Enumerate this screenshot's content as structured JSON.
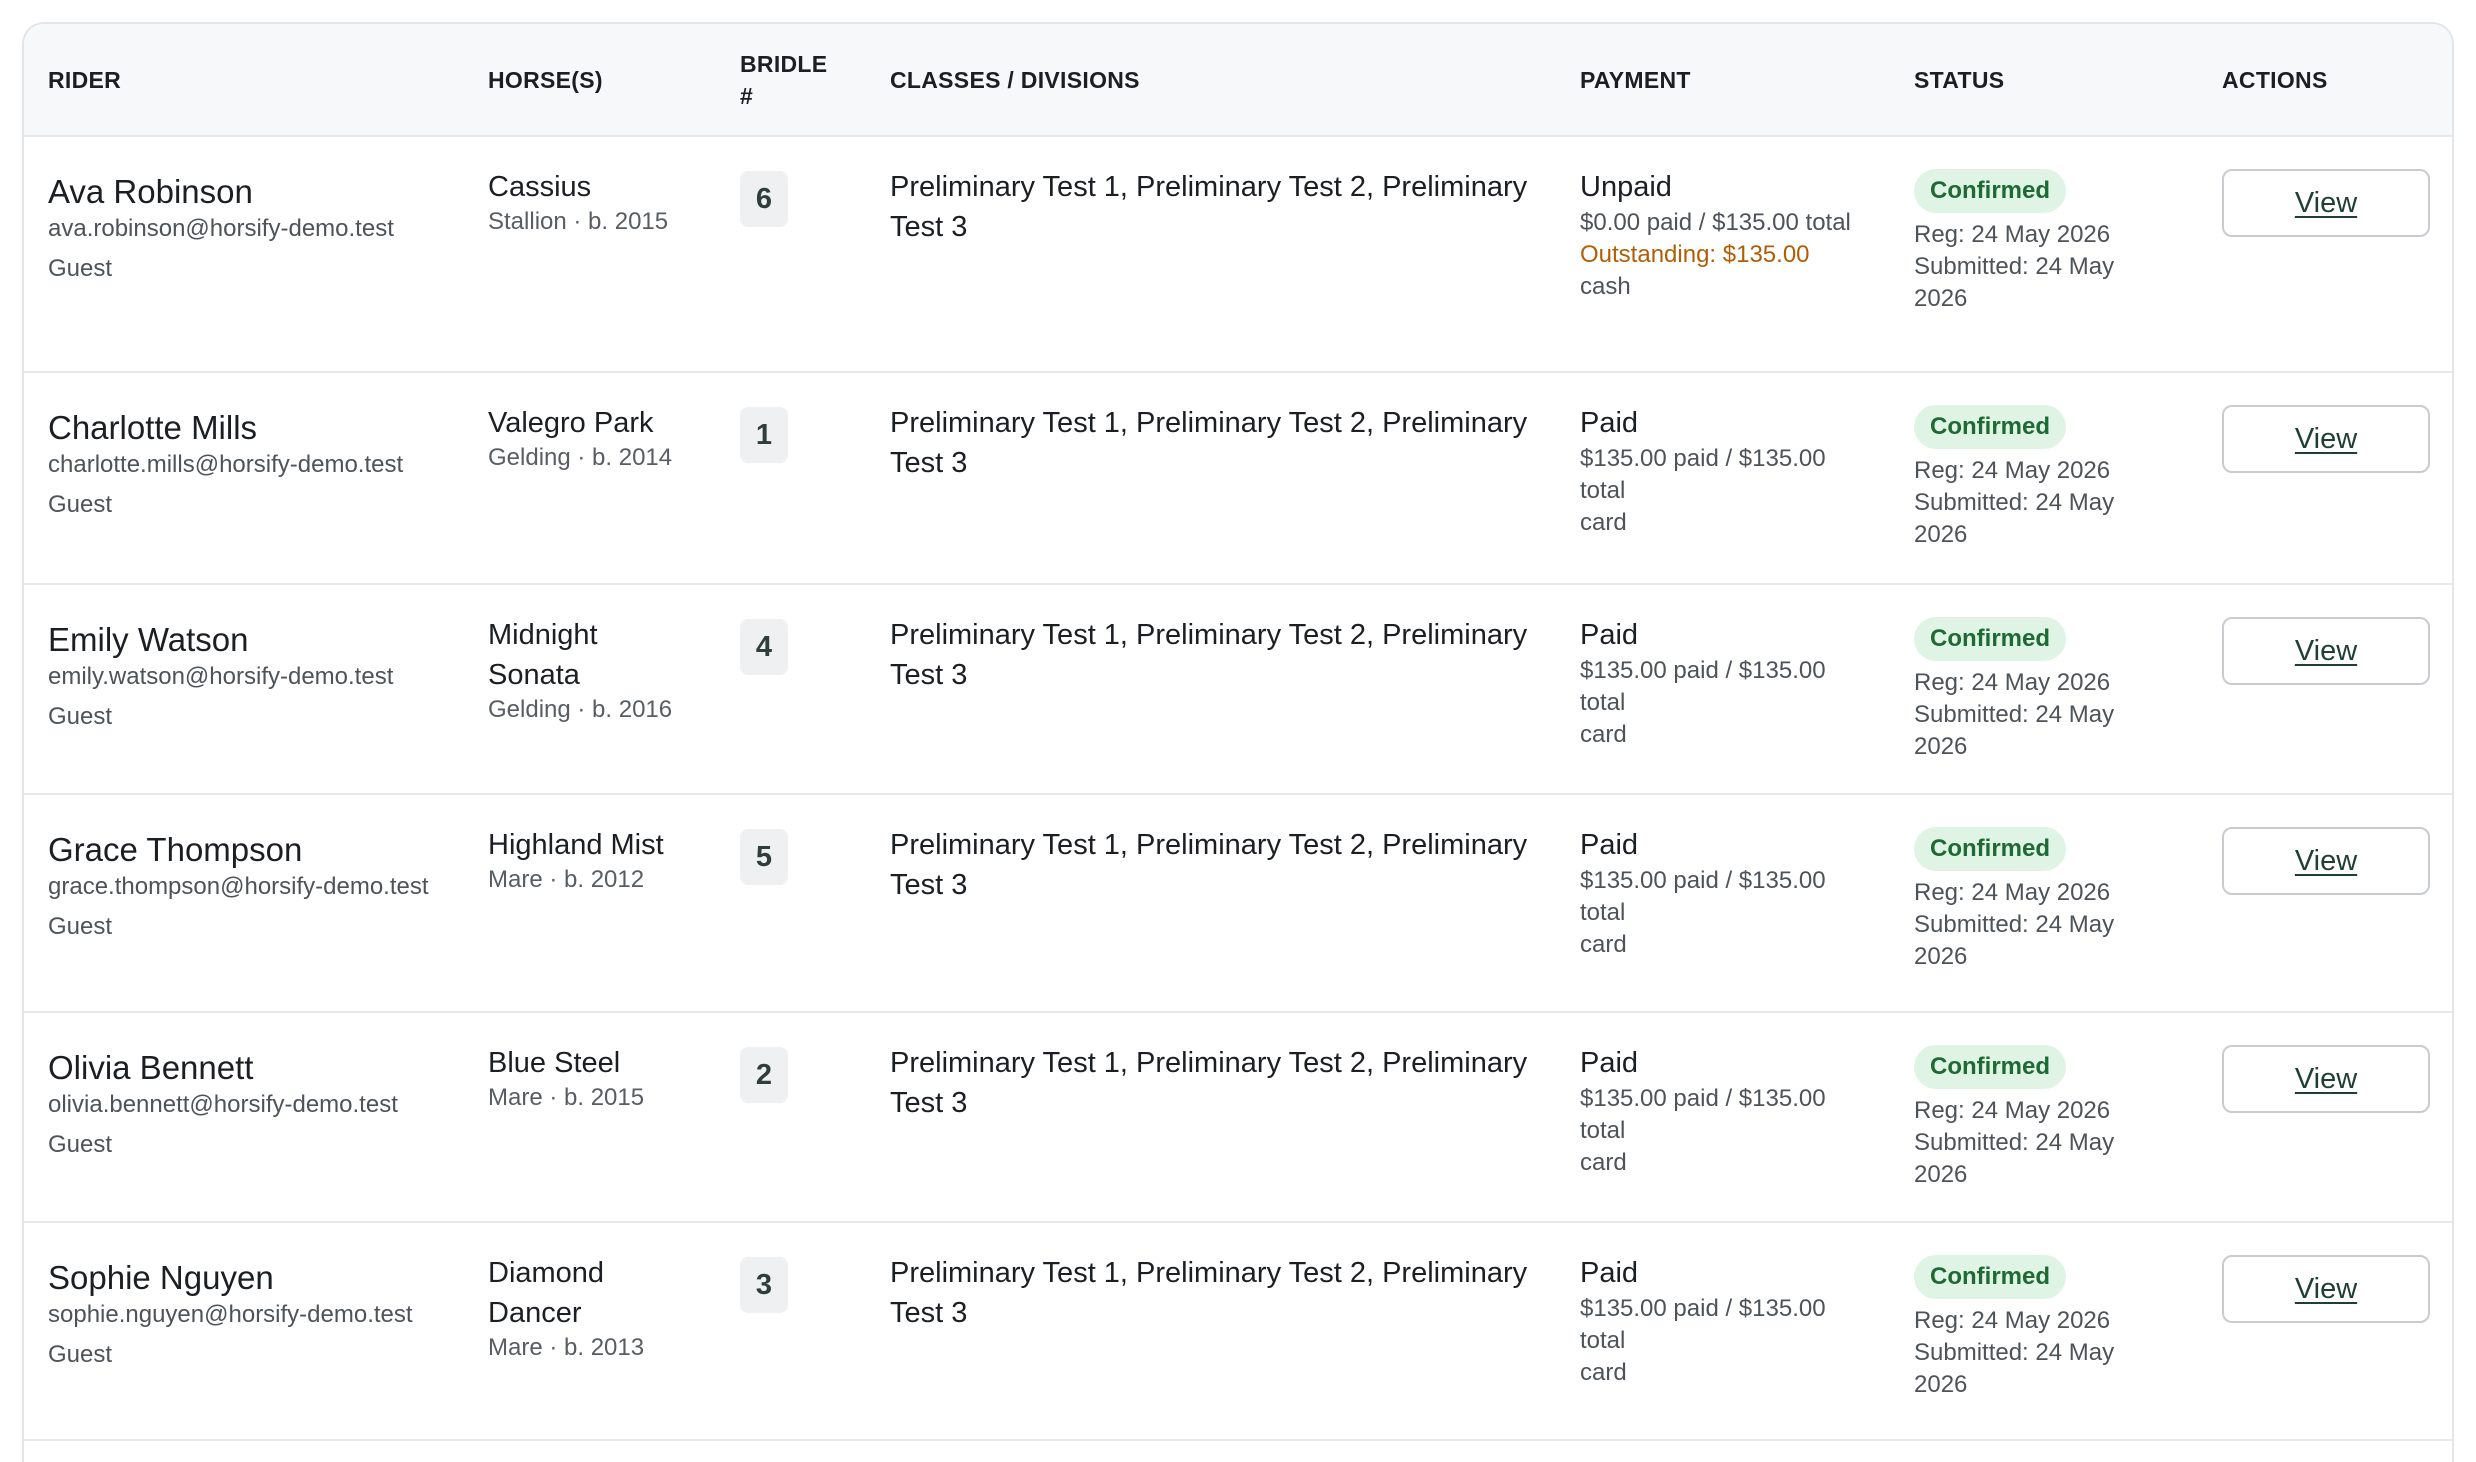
{
  "headers": {
    "rider": "RIDER",
    "horses": "HORSE(S)",
    "bridle": "BRIDLE #",
    "classes": "CLASSES / DIVISIONS",
    "payment": "PAYMENT",
    "status": "STATUS",
    "actions": "ACTIONS"
  },
  "rows": [
    {
      "rider_name": "Ava Robinson",
      "rider_email": "ava.robinson@horsify-demo.test",
      "rider_type": "Guest",
      "horse_name": "Cassius",
      "horse_meta": "Stallion · b. 2015",
      "bridle": "6",
      "classes": "Preliminary Test 1, Preliminary Test 2, Preliminary Test 3",
      "payment_status": "Unpaid",
      "payment_amount": "$0.00 paid / $135.00 total",
      "payment_outstanding": "Outstanding: $135.00",
      "payment_method": "cash",
      "status": "Confirmed",
      "reg_date": "Reg: 24 May 2026",
      "submitted_date": "Submitted: 24 May 2026",
      "action_label": "View"
    },
    {
      "rider_name": "Charlotte Mills",
      "rider_email": "charlotte.mills@horsify-demo.test",
      "rider_type": "Guest",
      "horse_name": "Valegro Park",
      "horse_meta": "Gelding · b. 2014",
      "bridle": "1",
      "classes": "Preliminary Test 1, Preliminary Test 2, Preliminary Test 3",
      "payment_status": "Paid",
      "payment_amount": "$135.00 paid / $135.00 total",
      "payment_method": "card",
      "status": "Confirmed",
      "reg_date": "Reg: 24 May 2026",
      "submitted_date": "Submitted: 24 May 2026",
      "action_label": "View"
    },
    {
      "rider_name": "Emily Watson",
      "rider_email": "emily.watson@horsify-demo.test",
      "rider_type": "Guest",
      "horse_name": "Midnight Sonata",
      "horse_meta": "Gelding · b. 2016",
      "bridle": "4",
      "classes": "Preliminary Test 1, Preliminary Test 2, Preliminary Test 3",
      "payment_status": "Paid",
      "payment_amount": "$135.00 paid / $135.00 total",
      "payment_method": "card",
      "status": "Confirmed",
      "reg_date": "Reg: 24 May 2026",
      "submitted_date": "Submitted: 24 May 2026",
      "action_label": "View"
    },
    {
      "rider_name": "Grace Thompson",
      "rider_email": "grace.thompson@horsify-demo.test",
      "rider_type": "Guest",
      "horse_name": "Highland Mist",
      "horse_meta": "Mare · b. 2012",
      "bridle": "5",
      "classes": "Preliminary Test 1, Preliminary Test 2, Preliminary Test 3",
      "payment_status": "Paid",
      "payment_amount": "$135.00 paid / $135.00 total",
      "payment_method": "card",
      "status": "Confirmed",
      "reg_date": "Reg: 24 May 2026",
      "submitted_date": "Submitted: 24 May 2026",
      "action_label": "View"
    },
    {
      "rider_name": "Olivia Bennett",
      "rider_email": "olivia.bennett@horsify-demo.test",
      "rider_type": "Guest",
      "horse_name": "Blue Steel",
      "horse_meta": "Mare · b. 2015",
      "bridle": "2",
      "classes": "Preliminary Test 1, Preliminary Test 2, Preliminary Test 3",
      "payment_status": "Paid",
      "payment_amount": "$135.00 paid / $135.00 total",
      "payment_method": "card",
      "status": "Confirmed",
      "reg_date": "Reg: 24 May 2026",
      "submitted_date": "Submitted: 24 May 2026",
      "action_label": "View"
    },
    {
      "rider_name": "Sophie Nguyen",
      "rider_email": "sophie.nguyen@horsify-demo.test",
      "rider_type": "Guest",
      "horse_name": "Diamond Dancer",
      "horse_meta": "Mare · b. 2013",
      "bridle": "3",
      "classes": "Preliminary Test 1, Preliminary Test 2, Preliminary Test 3",
      "payment_status": "Paid",
      "payment_amount": "$135.00 paid / $135.00 total",
      "payment_method": "card",
      "status": "Confirmed",
      "reg_date": "Reg: 24 May 2026",
      "submitted_date": "Submitted: 24 May 2026",
      "action_label": "View"
    }
  ],
  "colors": {
    "status_badge_bg": "#dff4e4",
    "status_badge_text": "#1f6a34",
    "outstanding_text": "#b05e06"
  }
}
